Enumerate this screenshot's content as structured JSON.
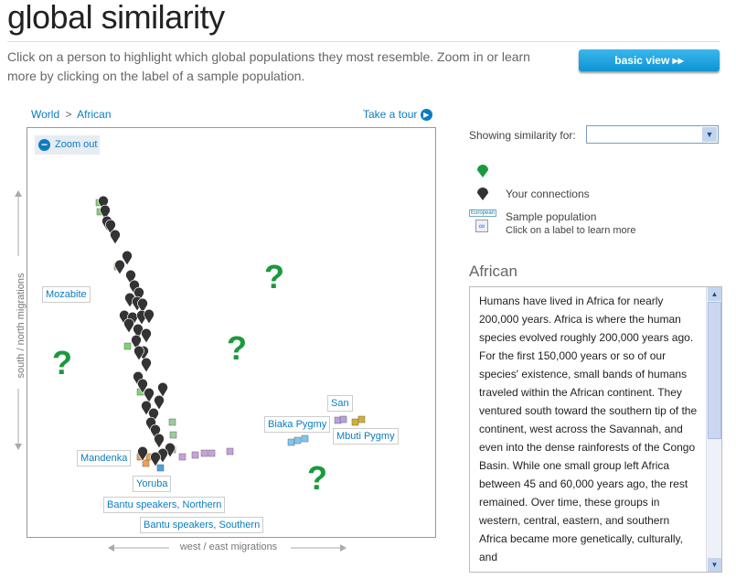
{
  "header": {
    "title": "global similarity",
    "intro": "Click on a person to highlight which global populations they most resemble. Zoom in or learn more by clicking on the label of a sample population.",
    "basic_view": "basic view ▸▸"
  },
  "nav": {
    "world": "World",
    "sep": ">",
    "african": "African",
    "tour": "Take a tour",
    "zoom_out": "Zoom out"
  },
  "plot": {
    "ylabel": "south / north migrations",
    "xlabel": "west / east migrations",
    "unknown_marker": "?",
    "labels": [
      "Mozabite",
      "Mandenka",
      "Yoruba",
      "Bantu speakers, Northern",
      "Bantu speakers, Southern",
      "Biaka Pygmy",
      "San",
      "Mbuti Pygmy"
    ],
    "colors": {
      "pin": "#333333",
      "highlight": "#1a9a3c",
      "link": "#0a7cc2"
    }
  },
  "sidebar": {
    "showing_label": "Showing similarity for:",
    "select_value": "",
    "legend": [
      {
        "icon": "green-pin",
        "label": ""
      },
      {
        "icon": "dark-pin",
        "label": "Your connections"
      },
      {
        "icon": "sample-population",
        "label": "Sample population",
        "sub": "Click on a label to learn more",
        "mini": "European"
      }
    ],
    "region_title": "African",
    "description": "Humans have lived in Africa for nearly 200,000 years. Africa is where the human species evolved roughly 200,000 years ago. For the first 150,000 years or so of our species' existence, small bands of humans traveled within the African continent. They ventured south toward the southern tip of the continent, west across the Savannah, and even into the dense rainforests of the Congo Basin. While one small group left Africa between 45 and 60,000 years ago, the rest remained. Over time, these groups in western, central, eastern, and southern Africa became more genetically, culturally, and"
  }
}
